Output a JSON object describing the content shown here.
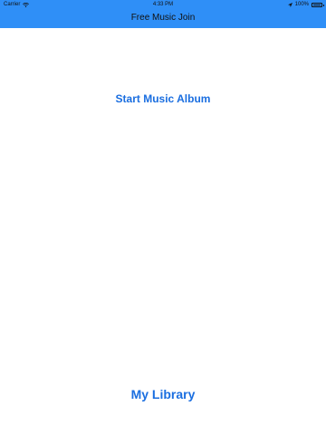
{
  "status_bar": {
    "carrier": "Carrier",
    "time": "4:33 PM",
    "battery": "100%",
    "icons": [
      "wifi-icon",
      "location-icon",
      "battery-icon"
    ]
  },
  "nav": {
    "title": "Free Music Join"
  },
  "main": {
    "start_album_label": "Start Music Album",
    "my_library_label": "My Library"
  },
  "colors": {
    "header_bg": "#2f8ff7",
    "link": "#1a6ee0",
    "background": "#ffffff"
  }
}
